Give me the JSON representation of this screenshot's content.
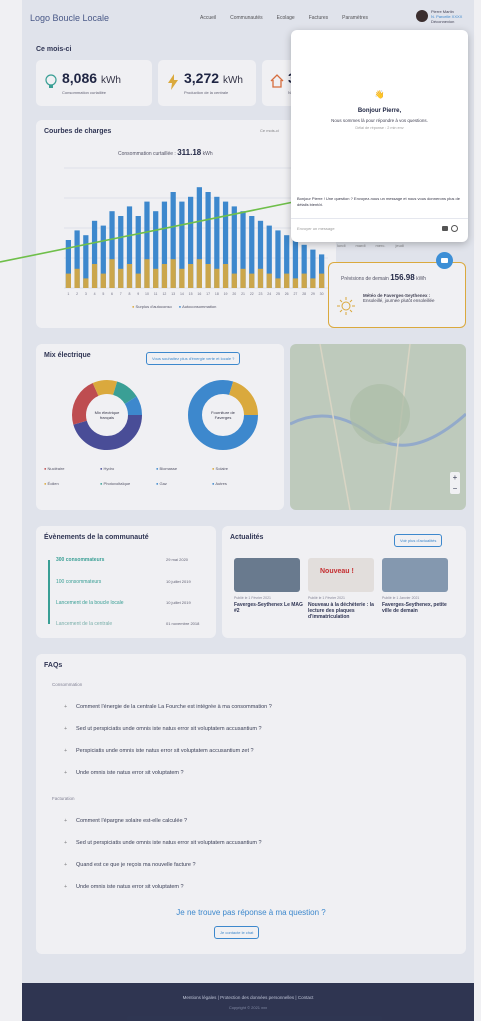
{
  "header": {
    "logo": "Logo Boucle Locale",
    "nav": [
      "Accueil",
      "Communautés",
      "Ecolage",
      "Factures",
      "Paramètres"
    ],
    "user_line1": "Pierre Martin",
    "user_line2": "N. Parcelle XXXX",
    "user_line3": "Déconnexion"
  },
  "month": {
    "title": "Ce mois-ci",
    "stats": [
      {
        "value": "8,086",
        "unit": "kWh",
        "label": "Consommation curtaillée"
      },
      {
        "value": "3,272",
        "unit": "kWh",
        "label": "Production de la centrale"
      },
      {
        "value": "3",
        "unit": "",
        "label": "Non"
      }
    ]
  },
  "curves": {
    "title": "Courbes de charges",
    "subtitle": "Consommation curtaillée :",
    "value": "311.18",
    "unit": "kWh",
    "legend": [
      "Surplus d'autoconso",
      "Autoconsommation"
    ],
    "filter": "Ce mois-ci"
  },
  "chart_data": {
    "type": "bar",
    "categories": [
      "1",
      "2",
      "3",
      "4",
      "5",
      "6",
      "7",
      "8",
      "9",
      "10",
      "11",
      "12",
      "13",
      "14",
      "15",
      "16",
      "17",
      "18",
      "19",
      "20",
      "21",
      "22",
      "23",
      "24",
      "25",
      "26",
      "27",
      "28",
      "29",
      "30"
    ],
    "series": [
      {
        "name": "Surplus d'autoconso",
        "values": [
          3,
          4,
          2,
          5,
          3,
          6,
          4,
          5,
          3,
          6,
          4,
          5,
          6,
          4,
          5,
          6,
          5,
          4,
          5,
          3,
          4,
          3,
          4,
          3,
          2,
          3,
          2,
          3,
          2,
          3
        ]
      },
      {
        "name": "Autoconsommation",
        "values": [
          10,
          12,
          11,
          14,
          13,
          16,
          15,
          17,
          15,
          18,
          16,
          18,
          20,
          18,
          19,
          21,
          20,
          19,
          18,
          17,
          16,
          15,
          14,
          13,
          12,
          11,
          10,
          9,
          8,
          7
        ]
      }
    ],
    "ylim": [
      0,
      25
    ]
  },
  "forecast": {
    "label": "Prévisions de demain",
    "value": "156.98",
    "unit": "kWh",
    "note": "Météo de Faverges-Seythenex :",
    "note2": "Ensoleillé, journée plutôt ensoleillée",
    "days": [
      "lundi",
      "mardi",
      "merc.",
      "jeudi"
    ]
  },
  "mix": {
    "title": "Mix électrique",
    "button": "Vous souhaitez plus d'énergie verte et locale ?",
    "donut1": "Mix électrique français",
    "donut2": "Fourniture de Faverges",
    "legend": [
      "Nucléaire",
      "Hydro",
      "Biomasse",
      "Solaire",
      "Éolien",
      "Photovoltaïque",
      "Gaz",
      "Autres"
    ]
  },
  "events": {
    "title": "Évènements de la communauté",
    "items": [
      {
        "label": "300 consommateurs",
        "date": "29 mai 2020"
      },
      {
        "label": "100 consommateurs",
        "date": "10 juillet 2019"
      },
      {
        "label": "Lancement de la boucle locale",
        "date": "10 juillet 2019"
      },
      {
        "label": "Lancement de la centrale",
        "date": "01 novembre 2018"
      }
    ]
  },
  "news": {
    "title": "Actualités",
    "button": "Voir plus d'actualités",
    "items": [
      {
        "date": "Publié le 1 Février 2021",
        "title": "Faverges-Seythenex Le MAG #2"
      },
      {
        "date": "Publié le 1 Février 2021",
        "title": "Nouveau à la déchèterie : la lecture des plaques d'immatriculation"
      },
      {
        "date": "Publié le 1 Janvier 2021",
        "title": "Faverges-Seythenex, petite ville de demain"
      }
    ],
    "badge": "Nouveau !"
  },
  "faq": {
    "title": "FAQs",
    "group1": "Consommation",
    "q1": [
      "Comment l'énergie de la centrale La Fourche est intégrée à ma consommation ?",
      "Sed ut perspiciatis unde omnis iste natus error sit voluptatem accusantium ?",
      "Perspiciatis unde omnis iste natus error sit voluptatem accusantium zet ?",
      "Unde omnis iste natus error sit voluptatem ?"
    ],
    "group2": "Facturation",
    "q2": [
      "Comment l'épargne solaire est-elle calculée ?",
      "Sed ut perspiciatis unde omnis iste natus error sit voluptatem accusantium ?",
      "Quand est ce que je reçois ma nouvelle facture ?",
      "Unde omnis iste natus error sit voluptatem ?"
    ],
    "missing": "Je ne trouve pas réponse à ma question ?",
    "chat_button": "Je contacte le chat"
  },
  "footer": {
    "links": "Mentions légales | Protection des données personnelles | Contact",
    "copy": "Copyright © 2021 xxx"
  },
  "chat": {
    "emoji": "👋",
    "greeting": "Bonjour Pierre,",
    "sub": "Nous sommes là pour répondre à vos questions.",
    "time": "Délai de réponse : 2 min env",
    "message": "Bonjour Pierre ! Une question ? Envoyez-nous un message et nous vous donnerons plus de détails bientôt.",
    "placeholder": "Envoyer un message"
  }
}
